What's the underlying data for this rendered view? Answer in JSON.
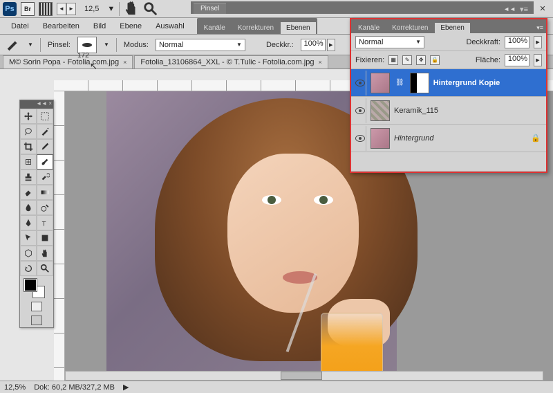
{
  "topbar": {
    "logo": "Ps",
    "br": "Br",
    "zoom": "12,5",
    "zoom_unit": "▼"
  },
  "pinsel_panel": {
    "tab": "Pinsel"
  },
  "menu": {
    "datei": "Datei",
    "bearbeiten": "Bearbeiten",
    "bild": "Bild",
    "ebene": "Ebene",
    "auswahl": "Auswahl"
  },
  "midtabs": {
    "kanale": "Kanäle",
    "korrekturen": "Korrekturen",
    "ebenen": "Ebenen"
  },
  "options": {
    "pinsel_label": "Pinsel:",
    "brush_size": "172",
    "modus_label": "Modus:",
    "modus_value": "Normal",
    "deckkr_label": "Deckkr.:",
    "deckkr_value": "100%"
  },
  "doctabs": {
    "t1": "M© Sorin Popa - Fotolia.com.jpg",
    "t2": "Fotolia_13106864_XXL - © T.Tulic - Fotolia.com.jpg"
  },
  "layers": {
    "tabs": {
      "kanale": "Kanäle",
      "korrekturen": "Korrekturen",
      "ebenen": "Ebenen"
    },
    "blend_value": "Normal",
    "deckkraft_label": "Deckkraft:",
    "deckkraft_value": "100%",
    "fixieren_label": "Fixieren:",
    "flaeche_label": "Fläche:",
    "flaeche_value": "100%",
    "items": [
      {
        "name": "Hintergrund Kopie"
      },
      {
        "name": "Keramik_115"
      },
      {
        "name": "Hintergrund"
      }
    ]
  },
  "status": {
    "zoom": "12,5%",
    "dok_label": "Dok:",
    "dok_value": "60,2 MB/327,2 MB"
  }
}
